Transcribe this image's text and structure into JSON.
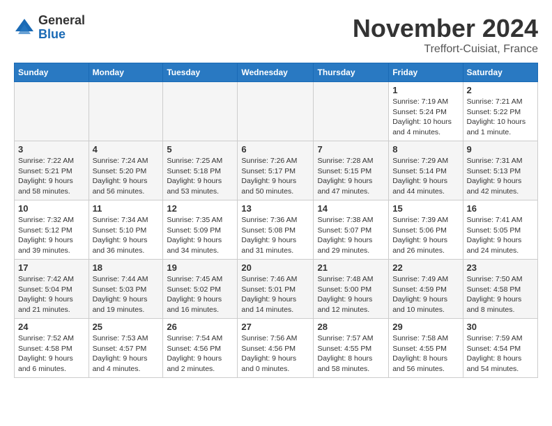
{
  "header": {
    "logo_general": "General",
    "logo_blue": "Blue",
    "month_title": "November 2024",
    "location": "Treffort-Cuisiat, France"
  },
  "days_of_week": [
    "Sunday",
    "Monday",
    "Tuesday",
    "Wednesday",
    "Thursday",
    "Friday",
    "Saturday"
  ],
  "weeks": [
    [
      {
        "day": "",
        "empty": true
      },
      {
        "day": "",
        "empty": true
      },
      {
        "day": "",
        "empty": true
      },
      {
        "day": "",
        "empty": true
      },
      {
        "day": "",
        "empty": true
      },
      {
        "day": "1",
        "sunrise": "Sunrise: 7:19 AM",
        "sunset": "Sunset: 5:24 PM",
        "daylight": "Daylight: 10 hours and 4 minutes."
      },
      {
        "day": "2",
        "sunrise": "Sunrise: 7:21 AM",
        "sunset": "Sunset: 5:22 PM",
        "daylight": "Daylight: 10 hours and 1 minute."
      }
    ],
    [
      {
        "day": "3",
        "sunrise": "Sunrise: 7:22 AM",
        "sunset": "Sunset: 5:21 PM",
        "daylight": "Daylight: 9 hours and 58 minutes."
      },
      {
        "day": "4",
        "sunrise": "Sunrise: 7:24 AM",
        "sunset": "Sunset: 5:20 PM",
        "daylight": "Daylight: 9 hours and 56 minutes."
      },
      {
        "day": "5",
        "sunrise": "Sunrise: 7:25 AM",
        "sunset": "Sunset: 5:18 PM",
        "daylight": "Daylight: 9 hours and 53 minutes."
      },
      {
        "day": "6",
        "sunrise": "Sunrise: 7:26 AM",
        "sunset": "Sunset: 5:17 PM",
        "daylight": "Daylight: 9 hours and 50 minutes."
      },
      {
        "day": "7",
        "sunrise": "Sunrise: 7:28 AM",
        "sunset": "Sunset: 5:15 PM",
        "daylight": "Daylight: 9 hours and 47 minutes."
      },
      {
        "day": "8",
        "sunrise": "Sunrise: 7:29 AM",
        "sunset": "Sunset: 5:14 PM",
        "daylight": "Daylight: 9 hours and 44 minutes."
      },
      {
        "day": "9",
        "sunrise": "Sunrise: 7:31 AM",
        "sunset": "Sunset: 5:13 PM",
        "daylight": "Daylight: 9 hours and 42 minutes."
      }
    ],
    [
      {
        "day": "10",
        "sunrise": "Sunrise: 7:32 AM",
        "sunset": "Sunset: 5:12 PM",
        "daylight": "Daylight: 9 hours and 39 minutes."
      },
      {
        "day": "11",
        "sunrise": "Sunrise: 7:34 AM",
        "sunset": "Sunset: 5:10 PM",
        "daylight": "Daylight: 9 hours and 36 minutes."
      },
      {
        "day": "12",
        "sunrise": "Sunrise: 7:35 AM",
        "sunset": "Sunset: 5:09 PM",
        "daylight": "Daylight: 9 hours and 34 minutes."
      },
      {
        "day": "13",
        "sunrise": "Sunrise: 7:36 AM",
        "sunset": "Sunset: 5:08 PM",
        "daylight": "Daylight: 9 hours and 31 minutes."
      },
      {
        "day": "14",
        "sunrise": "Sunrise: 7:38 AM",
        "sunset": "Sunset: 5:07 PM",
        "daylight": "Daylight: 9 hours and 29 minutes."
      },
      {
        "day": "15",
        "sunrise": "Sunrise: 7:39 AM",
        "sunset": "Sunset: 5:06 PM",
        "daylight": "Daylight: 9 hours and 26 minutes."
      },
      {
        "day": "16",
        "sunrise": "Sunrise: 7:41 AM",
        "sunset": "Sunset: 5:05 PM",
        "daylight": "Daylight: 9 hours and 24 minutes."
      }
    ],
    [
      {
        "day": "17",
        "sunrise": "Sunrise: 7:42 AM",
        "sunset": "Sunset: 5:04 PM",
        "daylight": "Daylight: 9 hours and 21 minutes."
      },
      {
        "day": "18",
        "sunrise": "Sunrise: 7:44 AM",
        "sunset": "Sunset: 5:03 PM",
        "daylight": "Daylight: 9 hours and 19 minutes."
      },
      {
        "day": "19",
        "sunrise": "Sunrise: 7:45 AM",
        "sunset": "Sunset: 5:02 PM",
        "daylight": "Daylight: 9 hours and 16 minutes."
      },
      {
        "day": "20",
        "sunrise": "Sunrise: 7:46 AM",
        "sunset": "Sunset: 5:01 PM",
        "daylight": "Daylight: 9 hours and 14 minutes."
      },
      {
        "day": "21",
        "sunrise": "Sunrise: 7:48 AM",
        "sunset": "Sunset: 5:00 PM",
        "daylight": "Daylight: 9 hours and 12 minutes."
      },
      {
        "day": "22",
        "sunrise": "Sunrise: 7:49 AM",
        "sunset": "Sunset: 4:59 PM",
        "daylight": "Daylight: 9 hours and 10 minutes."
      },
      {
        "day": "23",
        "sunrise": "Sunrise: 7:50 AM",
        "sunset": "Sunset: 4:58 PM",
        "daylight": "Daylight: 9 hours and 8 minutes."
      }
    ],
    [
      {
        "day": "24",
        "sunrise": "Sunrise: 7:52 AM",
        "sunset": "Sunset: 4:58 PM",
        "daylight": "Daylight: 9 hours and 6 minutes."
      },
      {
        "day": "25",
        "sunrise": "Sunrise: 7:53 AM",
        "sunset": "Sunset: 4:57 PM",
        "daylight": "Daylight: 9 hours and 4 minutes."
      },
      {
        "day": "26",
        "sunrise": "Sunrise: 7:54 AM",
        "sunset": "Sunset: 4:56 PM",
        "daylight": "Daylight: 9 hours and 2 minutes."
      },
      {
        "day": "27",
        "sunrise": "Sunrise: 7:56 AM",
        "sunset": "Sunset: 4:56 PM",
        "daylight": "Daylight: 9 hours and 0 minutes."
      },
      {
        "day": "28",
        "sunrise": "Sunrise: 7:57 AM",
        "sunset": "Sunset: 4:55 PM",
        "daylight": "Daylight: 8 hours and 58 minutes."
      },
      {
        "day": "29",
        "sunrise": "Sunrise: 7:58 AM",
        "sunset": "Sunset: 4:55 PM",
        "daylight": "Daylight: 8 hours and 56 minutes."
      },
      {
        "day": "30",
        "sunrise": "Sunrise: 7:59 AM",
        "sunset": "Sunset: 4:54 PM",
        "daylight": "Daylight: 8 hours and 54 minutes."
      }
    ]
  ]
}
